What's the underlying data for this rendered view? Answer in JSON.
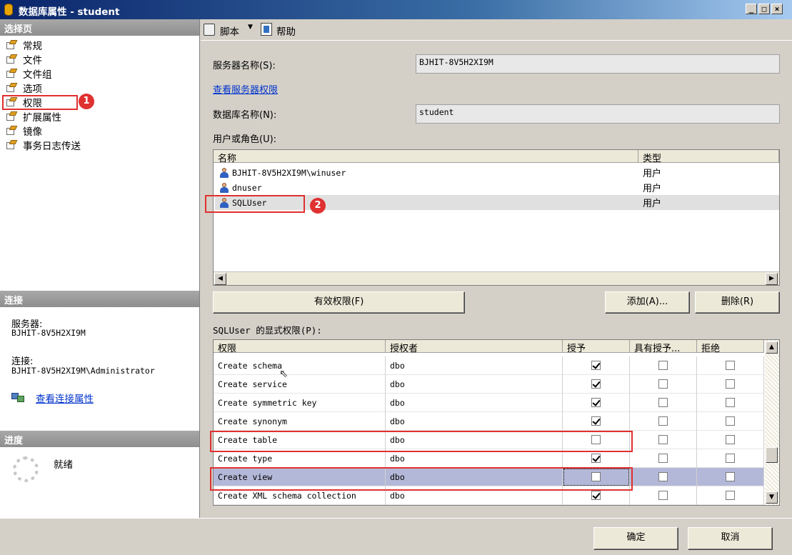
{
  "window": {
    "title": "数据库属性 - student"
  },
  "left": {
    "select_page_header": "选择页",
    "pages": [
      "常规",
      "文件",
      "文件组",
      "选项",
      "权限",
      "扩展属性",
      "镜像",
      "事务日志传送"
    ],
    "selected_index": 4,
    "connection_header": "连接",
    "server_label": "服务器:",
    "server_value": "BJHIT-8V5H2XI9M",
    "connection_label": "连接:",
    "connection_value": "BJHIT-8V5H2XI9M\\Administrator",
    "view_conn_props": "查看连接属性",
    "progress_header": "进度",
    "progress_status": "就绪"
  },
  "toolbar": {
    "script": "脚本",
    "help": "帮助"
  },
  "form": {
    "server_name_label": "服务器名称(S):",
    "server_name_value": "BJHIT-8V5H2XI9M",
    "view_server_perms": "查看服务器权限",
    "db_name_label": "数据库名称(N):",
    "db_name_value": "student",
    "users_label": "用户或角色(U):"
  },
  "users": {
    "col_name": "名称",
    "col_type": "类型",
    "rows": [
      {
        "name": "BJHIT-8V5H2XI9M\\winuser",
        "type": "用户"
      },
      {
        "name": "dnuser",
        "type": "用户"
      },
      {
        "name": "SQLUser",
        "type": "用户"
      }
    ],
    "selected_index": 2
  },
  "buttons": {
    "effective_perms": "有效权限(F)",
    "add": "添加(A)...",
    "remove": "删除(R)",
    "ok": "确定",
    "cancel": "取消"
  },
  "perms": {
    "label": "SQLUser 的显式权限(P):",
    "columns": [
      "权限",
      "授权者",
      "授予",
      "具有授予...",
      "拒绝"
    ],
    "rows": [
      {
        "permission": "Create schema",
        "grantor": "dbo",
        "grant": true,
        "with_grant": false,
        "deny": false
      },
      {
        "permission": "Create service",
        "grantor": "dbo",
        "grant": true,
        "with_grant": false,
        "deny": false
      },
      {
        "permission": "Create symmetric key",
        "grantor": "dbo",
        "grant": true,
        "with_grant": false,
        "deny": false
      },
      {
        "permission": "Create synonym",
        "grantor": "dbo",
        "grant": true,
        "with_grant": false,
        "deny": false
      },
      {
        "permission": "Create table",
        "grantor": "dbo",
        "grant": false,
        "with_grant": false,
        "deny": false
      },
      {
        "permission": "Create type",
        "grantor": "dbo",
        "grant": true,
        "with_grant": false,
        "deny": false
      },
      {
        "permission": "Create view",
        "grantor": "dbo",
        "grant": false,
        "with_grant": false,
        "deny": false
      },
      {
        "permission": "Create XML schema collection",
        "grantor": "dbo",
        "grant": true,
        "with_grant": false,
        "deny": false
      }
    ],
    "selected_index": 6
  },
  "annotations": [
    "1",
    "2"
  ],
  "colors": {
    "highlight_box": "#e03030",
    "selected_row": "#b4b8d8",
    "title_bar": "#0a246a"
  }
}
